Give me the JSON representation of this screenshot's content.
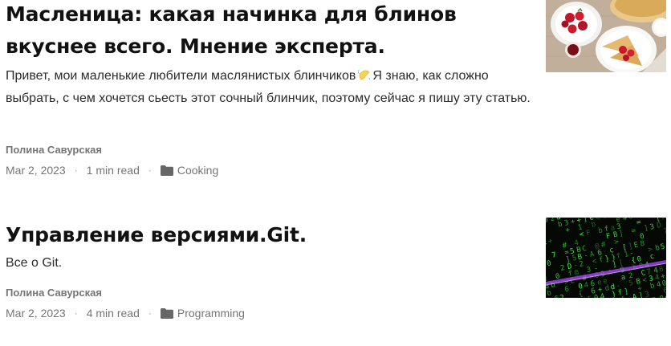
{
  "posts": [
    {
      "title": "Масленица: какая начинка для блинов вкуснее всего. Мнение эксперта.",
      "excerpt_before": "Привет, мои маленькие любители маслянистых блинчиков",
      "excerpt_emoji": "wave-emoji",
      "excerpt_after": "Я знаю, как сложно выбрать, с чем хочется сьесть этот сочный блинчик, поэтому сейчас я пишу эту статью.",
      "author": "Полина Савурская",
      "date": "Mar 2, 2023",
      "read_time": "1 min read",
      "category": "Cooking",
      "thumbnail_icon": "pancakes-with-strawberries-photo"
    },
    {
      "title": "Управление версиями.Git.",
      "excerpt": "Все о Git.",
      "author": "Полина Савурская",
      "date": "Mar 2, 2023",
      "read_time": "4 min read",
      "category": "Programming",
      "thumbnail_icon": "green-code-matrix-photo"
    }
  ],
  "separator": "·",
  "colors": {
    "title": "#111111",
    "meta": "#757575",
    "folder_icon": "#666666",
    "code_green": "#3cff3c"
  }
}
